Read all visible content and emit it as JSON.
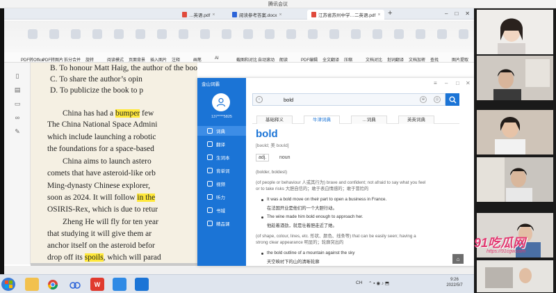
{
  "meeting": {
    "title": "腾讯会议"
  },
  "browser": {
    "tabs": [
      {
        "label": "…英语.pdf",
        "icon_color": "#e04a3c",
        "active": false
      },
      {
        "label": "阅读参考答案.docx",
        "icon_color": "#2b63d8",
        "active": false
      },
      {
        "label": "江苏省苏州中学…二英语.pdf",
        "icon_color": "#e04a3c",
        "active": true
      }
    ],
    "add_tab": "+"
  },
  "ribbon": {
    "buttons": [
      "PDF转Office",
      "PDF转图片",
      "拆分合并",
      "旋转",
      "阅读模式",
      "页面背景",
      "插入图片",
      "注释",
      "画笔",
      "AI",
      "截图和对比",
      "自动滚动",
      "朗读",
      "PDF编辑",
      "全文翻译",
      "压缩",
      "文档对比",
      "划词翻译",
      "文档加密",
      "查找",
      "图片提取"
    ]
  },
  "document": {
    "options": [
      "B.  To honour Matt Haig, the author of the book.",
      "C.  To share the author’s opin",
      "D.  To publicize the book to p"
    ],
    "lines": [
      {
        "pre": "China has had a ",
        "hl": "bumper",
        "post": " few"
      },
      {
        "pre": "The China National Space Admini",
        "hl": "",
        "post": ""
      },
      {
        "pre": "which include launching a robotic",
        "hl": "",
        "post": ""
      },
      {
        "pre": "the foundations for a space-based",
        "hl": "",
        "post": ""
      },
      {
        "pre": "China aims to launch astero",
        "hl": "",
        "post": ""
      },
      {
        "pre": "comets that have asteroid-like orb",
        "hl": "",
        "post": ""
      },
      {
        "pre": "Ming-dynasty Chinese explorer, ",
        "hl": "",
        "post": ""
      },
      {
        "pre": "soon as 2024. It will follow ",
        "hl": "in the",
        "post": ""
      },
      {
        "pre": "OSIRIS-Rex, which is due to retur",
        "hl": "",
        "post": ""
      },
      {
        "pre": "Zheng He will fly for ten year",
        "hl": "",
        "post": ""
      },
      {
        "pre": "that studying it will give them ar",
        "hl": "",
        "post": ""
      },
      {
        "pre": "anchor itself on the asteroid befor",
        "hl": "",
        "post": ""
      },
      {
        "pre": "drop off its ",
        "hl": "spoils",
        "post": ", which will parad"
      }
    ]
  },
  "dictionary": {
    "brand": "金山词霸",
    "user_id": "137****5825",
    "nav": [
      "词典",
      "翻译",
      "生词本",
      "背单词",
      "视频",
      "听力",
      "书城",
      "精品课"
    ],
    "search_query": "bold",
    "tabs": [
      "基础释义",
      "牛津词典",
      "…词典",
      "英英词典"
    ],
    "headword": "bold",
    "phonetic": "[bəʊld; 美 boʊld]",
    "pos_tag": "adj.",
    "pos_label": "noun",
    "forms": "(bolder, boldest)",
    "sense1_en": "(of people or behaviour 人或其行为) brave and confident; not afraid to say what you feel",
    "sense1_en2": "or to take risks 大胆自信的；敢于表白情感的；敢于冒险的",
    "ex1_en": "It was a bold move on their part to open a business in France.",
    "ex1_zh": "在法国开业是他们的一个大胆行动。",
    "ex2_en": "The wine made him bold enough to approach her.",
    "ex2_zh": "他趁着酒劲，就是壮着胆走近了她。",
    "sense2_en": "(of shape, colour, lines, etc. 形状、颜色、线条等) that can be easily seen; having a",
    "sense2_en2": "strong clear appearance 明显的；轮廓突出的",
    "ex3_en": "the bold outline of a mountain against the sky",
    "ex3_zh": "天空映衬下的山的清晰轮廓",
    "home": "⌂"
  },
  "taskbar": {
    "tray_lang": "CH",
    "time": "9:26",
    "date": "2022/5/7"
  },
  "watermark": {
    "text": "91吃瓜网",
    "url": "https://91cgw.com"
  }
}
